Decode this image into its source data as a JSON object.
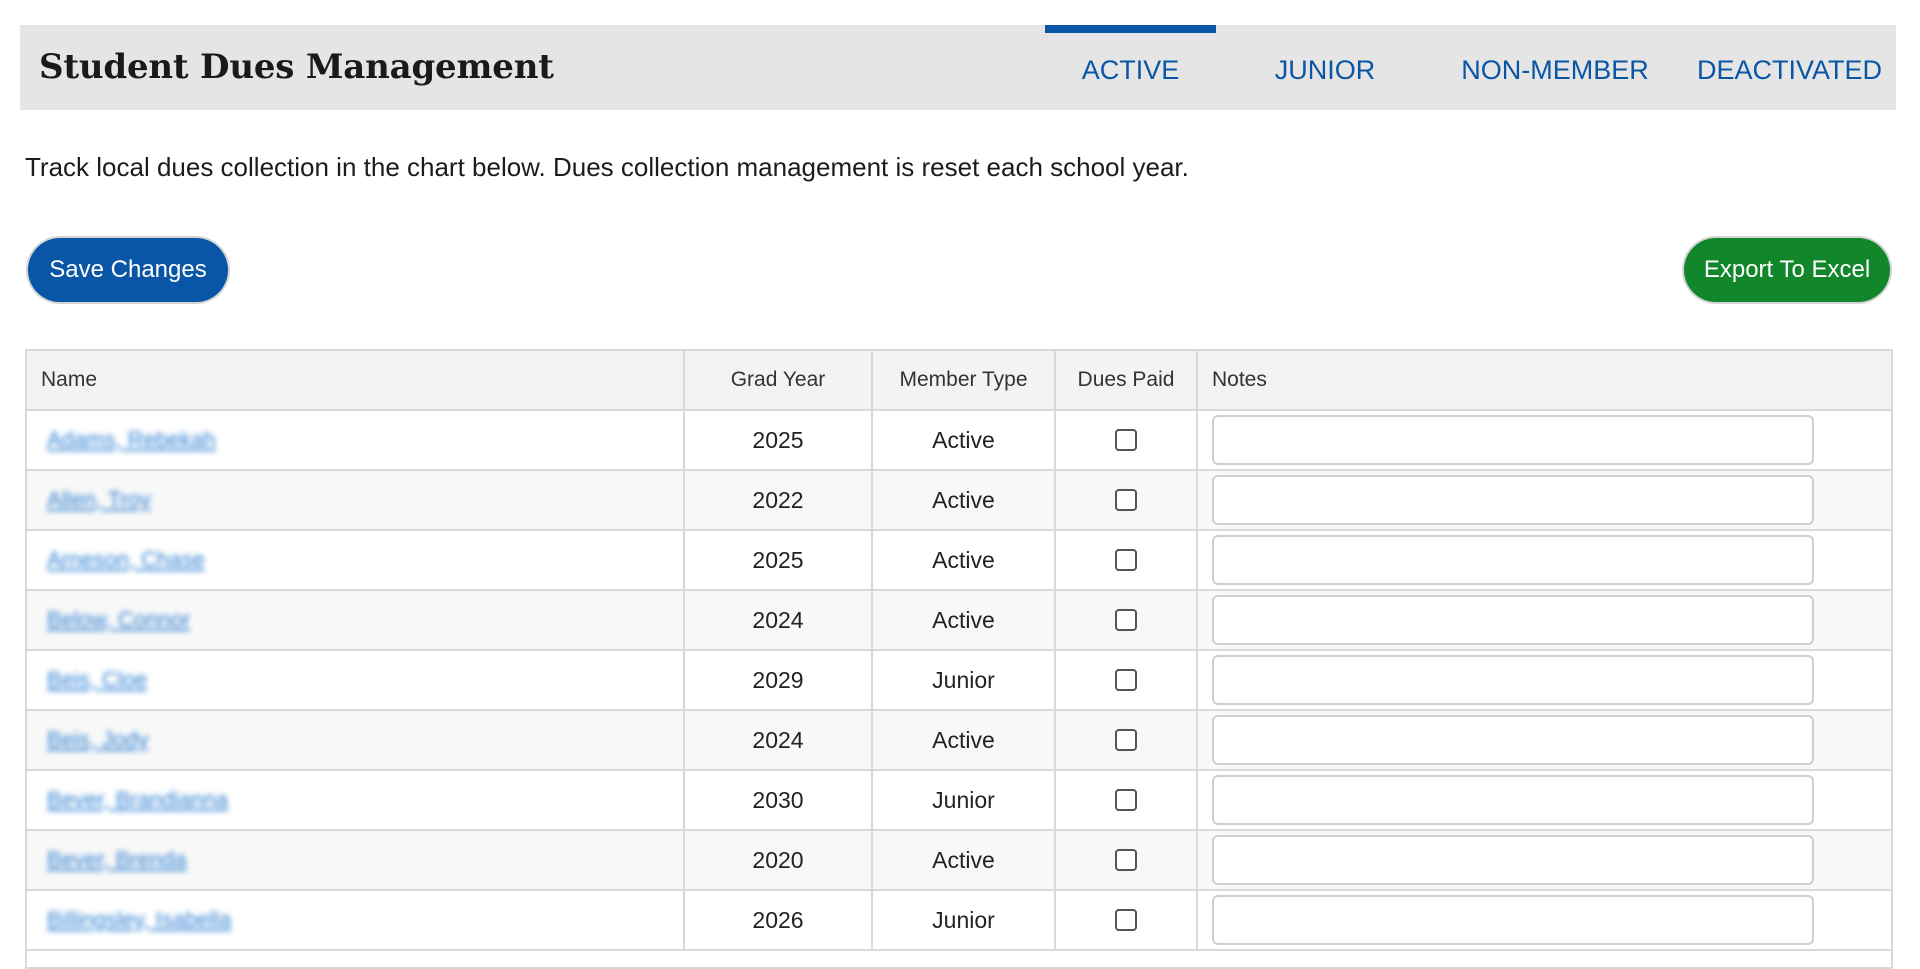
{
  "header": {
    "title": "Student Dues Management",
    "tabs": [
      {
        "label": "ACTIVE",
        "active": true
      },
      {
        "label": "JUNIOR",
        "active": false
      },
      {
        "label": "NON-MEMBER",
        "active": false
      },
      {
        "label": "DEACTIVATED",
        "active": false
      }
    ]
  },
  "intro_text": "Track local dues collection in the chart below. Dues collection management is reset each school year.",
  "actions": {
    "save_label": "Save Changes",
    "export_label": "Export To Excel"
  },
  "colors": {
    "brand_blue": "#0a56a6",
    "export_green": "#11862a",
    "header_bg": "#e5e5e5"
  },
  "table": {
    "headers": {
      "name": "Name",
      "grad_year": "Grad Year",
      "member_type": "Member Type",
      "dues_paid": "Dues Paid",
      "notes": "Notes"
    },
    "rows": [
      {
        "name": "Adams, Rebekah",
        "grad_year": "2025",
        "member_type": "Active",
        "dues_paid": false,
        "notes": ""
      },
      {
        "name": "Allen, Troy",
        "grad_year": "2022",
        "member_type": "Active",
        "dues_paid": false,
        "notes": ""
      },
      {
        "name": "Arneson, Chase",
        "grad_year": "2025",
        "member_type": "Active",
        "dues_paid": false,
        "notes": ""
      },
      {
        "name": "Below, Connor",
        "grad_year": "2024",
        "member_type": "Active",
        "dues_paid": false,
        "notes": ""
      },
      {
        "name": "Beis, Cloe",
        "grad_year": "2029",
        "member_type": "Junior",
        "dues_paid": false,
        "notes": ""
      },
      {
        "name": "Beis, Jody",
        "grad_year": "2024",
        "member_type": "Active",
        "dues_paid": false,
        "notes": ""
      },
      {
        "name": "Bever, Brandianna",
        "grad_year": "2030",
        "member_type": "Junior",
        "dues_paid": false,
        "notes": ""
      },
      {
        "name": "Bever, Brenda",
        "grad_year": "2020",
        "member_type": "Active",
        "dues_paid": false,
        "notes": ""
      },
      {
        "name": "Billingsley, Isabella",
        "grad_year": "2026",
        "member_type": "Junior",
        "dues_paid": false,
        "notes": ""
      }
    ]
  }
}
